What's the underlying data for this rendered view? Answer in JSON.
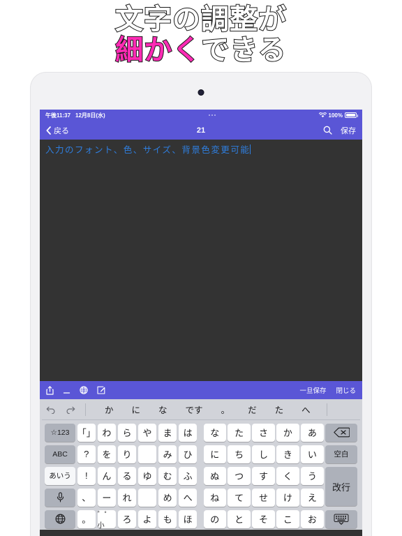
{
  "headline": {
    "line1": "文字の調整が",
    "line2_pink": "細かく",
    "line2_white": "できる"
  },
  "colors": {
    "header_purple": "#5a56d6",
    "editor_bg": "#333333",
    "editor_text": "#2f7fe0",
    "headline_pink": "#ff2bb5",
    "keyboard_bg": "#d1d3d9",
    "key_white": "#ffffff",
    "key_gray": "#adb1ba"
  },
  "status_bar": {
    "time": "午後11:37",
    "date": "12月8日(水)",
    "wifi_icon": "wifi-icon",
    "battery_percent": "100%",
    "battery_icon": "battery-icon",
    "center_indicator": "three-dots"
  },
  "nav_bar": {
    "back_icon": "chevron-left-icon",
    "back_label": "戻る",
    "title": "21",
    "search_icon": "search-icon",
    "save_label": "保存"
  },
  "editor": {
    "text": "入力のフォント、色、サイズ、背景色変更可能",
    "caret": "text-caret"
  },
  "toolbar": {
    "share_icon": "share-icon",
    "underscore_icon": "underscore-icon",
    "globe_icon": "globe-icon",
    "compose_icon": "compose-icon",
    "temp_save_label": "一旦保存",
    "close_label": "閉じる"
  },
  "keyboard": {
    "predictive": {
      "undo_icon": "undo-icon",
      "redo_icon": "redo-icon",
      "suggestions": [
        "か",
        "に",
        "な",
        "です",
        "。",
        "だ",
        "た",
        "へ"
      ]
    },
    "rows": [
      {
        "left_key": {
          "label": "☆123",
          "style": "dark"
        },
        "keys_left": [
          "「」",
          "わ",
          "ら",
          "や",
          "ま",
          "は"
        ],
        "keys_right": [
          "な",
          "た",
          "さ",
          "か",
          "あ"
        ],
        "right_key": {
          "label": "delete-icon",
          "style": "dark"
        }
      },
      {
        "left_key": {
          "label": "ABC",
          "style": "dark"
        },
        "keys_left": [
          "?",
          "を",
          "り",
          "",
          "み",
          "ひ"
        ],
        "keys_right": [
          "に",
          "ち",
          "し",
          "き",
          "い"
        ],
        "right_key": {
          "label": "空白",
          "style": "dark"
        }
      },
      {
        "left_key": {
          "label": "あいう",
          "style": "active-light"
        },
        "keys_left": [
          "!",
          "ん",
          "る",
          "ゆ",
          "む",
          "ふ"
        ],
        "keys_right": [
          "ぬ",
          "つ",
          "す",
          "く",
          "う"
        ],
        "right_key": {
          "label": "改行",
          "style": "dark-tall"
        }
      },
      {
        "left_key": {
          "label": "mic-icon",
          "style": "dark"
        },
        "keys_left": [
          "、",
          "ー",
          "れ",
          "",
          "め",
          "へ"
        ],
        "keys_right": [
          "ね",
          "て",
          "せ",
          "け",
          "え"
        ],
        "right_key": {
          "label": "",
          "style": "merged"
        }
      },
      {
        "left_key": {
          "label": "globe-icon",
          "style": "dark"
        },
        "keys_left": [
          "。",
          "゛゜小",
          "ろ",
          "よ",
          "も",
          "ほ"
        ],
        "keys_right": [
          "の",
          "と",
          "そ",
          "こ",
          "お"
        ],
        "right_key": {
          "label": "keyboard-dismiss-icon",
          "style": "dark"
        }
      }
    ]
  }
}
